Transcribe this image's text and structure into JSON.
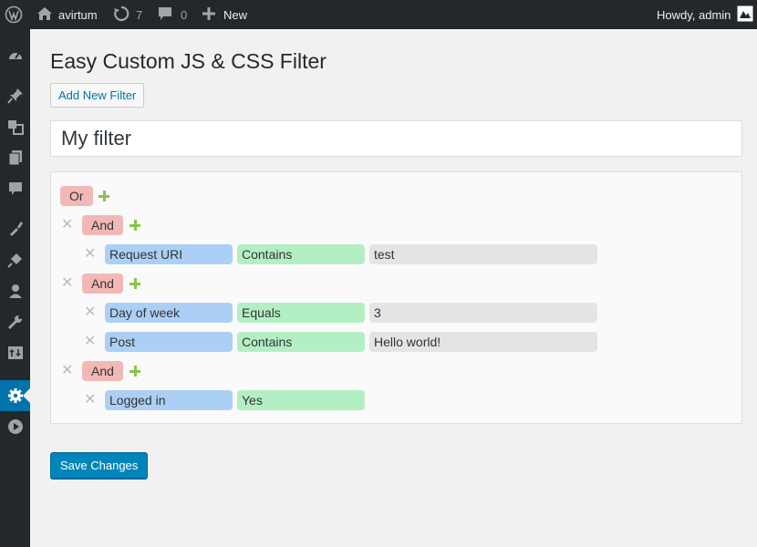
{
  "adminbar": {
    "site_name": "avirtum",
    "updates_count": "7",
    "comments_count": "0",
    "new_label": "New",
    "greeting": "Howdy, admin"
  },
  "sidebar": {
    "items": [
      {
        "icon": "dashboard-icon"
      },
      {
        "icon": "pin-icon"
      },
      {
        "icon": "media-icon"
      },
      {
        "icon": "pages-icon"
      },
      {
        "icon": "comments-icon"
      },
      {
        "icon": "appearance-icon"
      },
      {
        "icon": "plugins-icon"
      },
      {
        "icon": "users-icon"
      },
      {
        "icon": "tools-icon"
      },
      {
        "icon": "import-export-icon"
      },
      {
        "icon": "settings-icon",
        "active": true
      },
      {
        "icon": "play-icon"
      }
    ]
  },
  "page": {
    "title": "Easy Custom JS & CSS Filter",
    "add_new_label": "Add New Filter",
    "filter_name": "My filter",
    "save_label": "Save Changes"
  },
  "rules": {
    "root_op": "Or",
    "groups": [
      {
        "op": "And",
        "conditions": [
          {
            "field": "Request URI",
            "operator": "Contains",
            "value": "test"
          }
        ]
      },
      {
        "op": "And",
        "conditions": [
          {
            "field": "Day of week",
            "operator": "Equals",
            "value": "3"
          },
          {
            "field": "Post",
            "operator": "Contains",
            "value": "Hello world!"
          }
        ]
      },
      {
        "op": "And",
        "conditions": [
          {
            "field": "Logged in",
            "operator": "Yes",
            "value": ""
          }
        ]
      }
    ]
  },
  "colors": {
    "operator": "#f2b8b6",
    "field": "#acd0f5",
    "condition": "#b4efc4",
    "value": "#e3e4e6",
    "add": "#8bc34a",
    "primary": "#0085ba"
  }
}
